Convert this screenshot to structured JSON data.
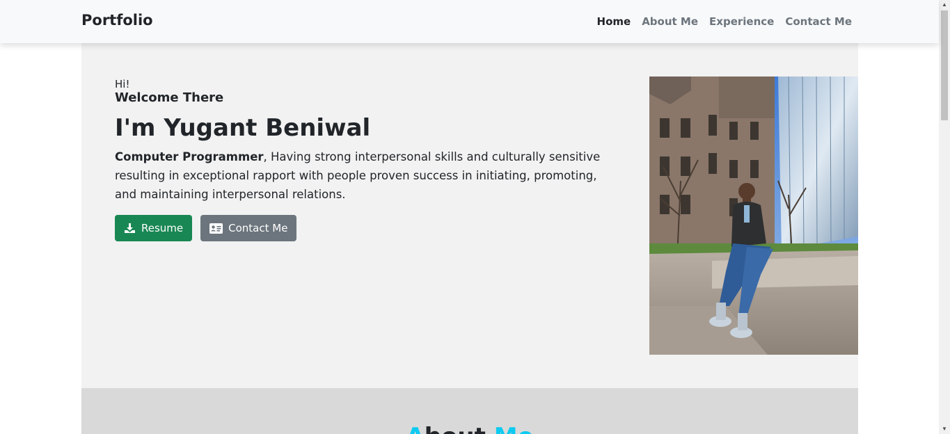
{
  "nav": {
    "brand": "Portfolio",
    "links": [
      "Home",
      "About Me",
      "Experience",
      "Contact Me"
    ]
  },
  "hero": {
    "greeting": "Hi!",
    "welcome": "Welcome There",
    "name": "I'm Yugant Beniwal",
    "role": "Computer Programmer",
    "description": ", Having strong interpersonal skills and culturally sensitive resulting in exceptional rapport with people proven success in initiating, promoting, and maintaining interpersonal relations.",
    "resume_button": "Resume",
    "contact_button": "Contact Me"
  },
  "about": {
    "title_part1": "A",
    "title_part2": "bout ",
    "title_part3": "M",
    "title_part4": "e"
  },
  "colors": {
    "accent_green": "#198754",
    "secondary_gray": "#6c757d",
    "highlight_cyan": "#0dcaf0"
  }
}
